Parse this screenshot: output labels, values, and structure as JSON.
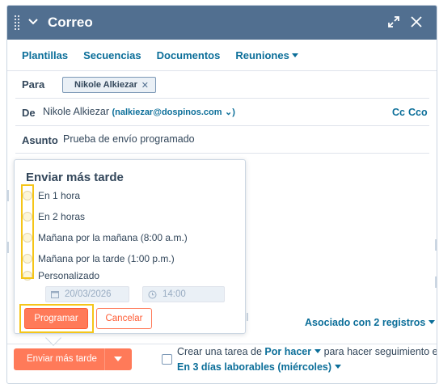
{
  "header": {
    "title": "Correo"
  },
  "tabs": [
    {
      "label": "Plantillas"
    },
    {
      "label": "Secuencias"
    },
    {
      "label": "Documentos"
    },
    {
      "label": "Reuniones"
    }
  ],
  "fields": {
    "to_label": "Para",
    "to_chip": "Nikole Alkiezar",
    "from_label": "De",
    "from_name": "Nikole Alkiezar",
    "from_email": "(nalkiezar@dospinos.com",
    "from_suffix": "⌄)",
    "cc": "Cc",
    "cco": "Cco",
    "subject_label": "Asunto",
    "subject_value": "Prueba de envío programado"
  },
  "schedule": {
    "title": "Enviar más tarde",
    "options": [
      "En 1 hora",
      "En 2 horas",
      "Mañana por la mañana (8:00 a.m.)",
      "Mañana por la tarde (1:00 p.m.)",
      "Personalizado"
    ],
    "date": "20/03/2026",
    "time": "14:00",
    "submit": "Programar",
    "cancel": "Cancelar"
  },
  "associated": "Asociado con 2 registros",
  "footer": {
    "send_later": "Enviar más tarde",
    "task_prefix": "Crear una tarea de",
    "task_type": "Por hacer",
    "task_middle": "para hacer seguimiento en",
    "task_when": "En 3 días laborables (miércoles)"
  },
  "colors": {
    "header_bg": "#516f90",
    "link": "#0b6e99",
    "primary": "#ff7a59",
    "highlight": "#f5c518"
  }
}
